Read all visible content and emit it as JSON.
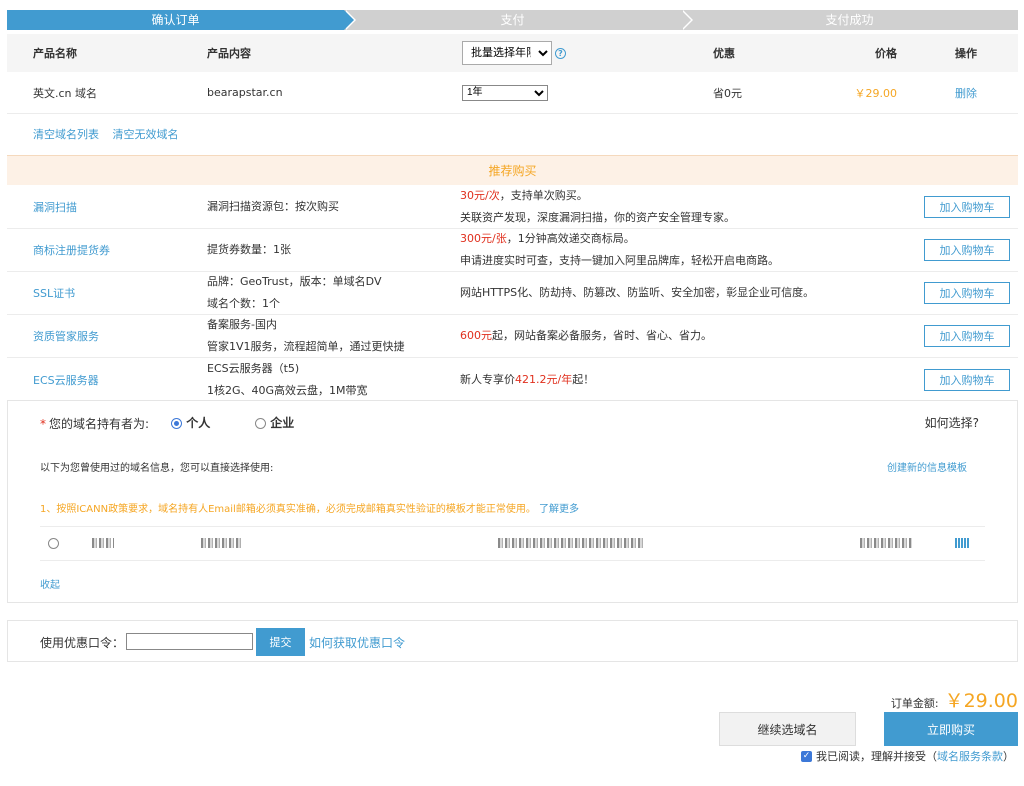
{
  "steps": [
    "确认订单",
    "支付",
    "支付成功"
  ],
  "table": {
    "headers": {
      "name": "产品名称",
      "content": "产品内容",
      "batch_select": "批量选择年限",
      "discount": "优惠",
      "price": "价格",
      "action": "操作"
    },
    "row": {
      "name": "英文.cn 域名",
      "content": "bearapstar.cn",
      "years": "1年",
      "discount": "省0元",
      "price": "￥29.00",
      "action": "删除"
    }
  },
  "clear_links": {
    "clear_list": "清空域名列表",
    "clear_invalid": "清空无效域名"
  },
  "recommend": {
    "title": "推荐购买",
    "button_label": "加入购物车",
    "items": [
      {
        "name": "漏洞扫描",
        "detail1": "漏洞扫描资源包：按次购买",
        "detail2": "",
        "price_red": "30元/次",
        "desc1": "，支持单次购买。",
        "desc2": "关联资产发现，深度漏洞扫描，你的资产安全管理专家。"
      },
      {
        "name": "商标注册提货券",
        "detail1": "提货券数量：1张",
        "detail2": "",
        "price_red": "300元/张",
        "desc1": "，1分钟高效递交商标局。",
        "desc2": "申请进度实时可查，支持一键加入阿里品牌库，轻松开启电商路。"
      },
      {
        "name": "SSL证书",
        "detail1": "品牌：GeoTrust，版本：单域名DV",
        "detail2": "域名个数：1个",
        "price_red": "",
        "desc1": "网站HTTPS化、防劫持、防篡改、防监听、安全加密，彰显企业可信度。",
        "desc2": ""
      },
      {
        "name": "资质管家服务",
        "detail1": "备案服务-国内",
        "detail2": "管家1V1服务，流程超简单，通过更快捷",
        "price_red": "600元",
        "desc1": "起，网站备案必备服务，省时、省心、省力。",
        "desc2": ""
      },
      {
        "name": "ECS云服务器",
        "detail1": "ECS云服务器（t5)",
        "detail2": "1核2G、40G高效云盘，1M带宽",
        "price_prefix": "新人专享价",
        "price_red": "421.2元/年",
        "desc1": "起！",
        "desc2": ""
      }
    ]
  },
  "holder": {
    "label": "您的域名持有者为:",
    "option_personal": "个人",
    "option_company": "企业",
    "how_to_choose": "如何选择?",
    "info_text": "以下为您曾使用过的域名信息，您可以直接选择使用:",
    "create_template": "创建新的信息模板",
    "warning": "1、按照ICANN政策要求，域名持有人Email邮箱必须真实准确，必须完成邮箱真实性验证的模板才能正常使用。",
    "learn_more": "了解更多",
    "collapse": "收起"
  },
  "coupon": {
    "label": "使用优惠口令：",
    "input_value": "",
    "submit": "提交",
    "how_to_get": "如何获取优惠口令"
  },
  "footer": {
    "total_label": "订单金额:",
    "total_value": "￥29.00",
    "continue_button": "继续选域名",
    "buy_button": "立即购买",
    "agree_text": "我已阅读，理解并接受",
    "terms_open": "（",
    "terms_link": "域名服务条款",
    "terms_close": "）"
  },
  "colors": {
    "primary": "#419bd0",
    "price": "#f5a623",
    "red": "#e0301e"
  }
}
